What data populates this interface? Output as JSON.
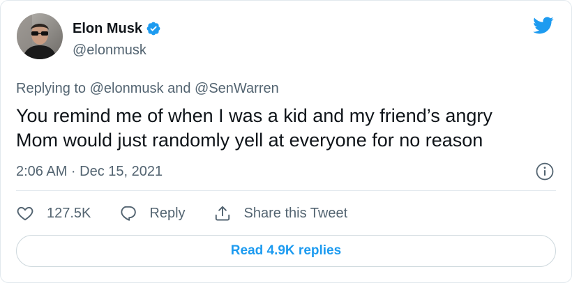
{
  "author": {
    "name": "Elon Musk",
    "handle": "@elonmusk",
    "verified": true
  },
  "reply_context": {
    "prefix": "Replying to",
    "mention_1": "@elonmusk",
    "conjunction": "and",
    "mention_2": "@SenWarren"
  },
  "tweet": {
    "line_1": "You remind me of when I was a kid and my friend’s angry",
    "line_2": "Mom would just randomly yell at everyone for no reason",
    "timestamp": "2:06 AM · Dec 15, 2021"
  },
  "actions": {
    "like_count": "127.5K",
    "reply_label": "Reply",
    "share_label": "Share this Tweet"
  },
  "read_replies_label": "Read 4.9K replies",
  "icons": {
    "brand": "twitter-bird-icon",
    "verified": "verified-badge-icon",
    "info": "info-icon",
    "like": "heart-icon",
    "reply": "speech-bubble-icon",
    "share": "share-upload-icon"
  },
  "colors": {
    "brand_blue": "#1d9bf0",
    "text_primary": "#0f1419",
    "text_secondary": "#536471",
    "border": "#e1e8ed"
  }
}
